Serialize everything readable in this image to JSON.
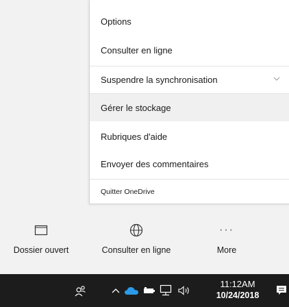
{
  "menu": {
    "items": [
      {
        "label": "Options"
      },
      {
        "label": "Consulter en ligne"
      },
      {
        "label": "Suspendre la synchronisation"
      },
      {
        "label": "Gérer le stockage"
      },
      {
        "label": "Rubriques d'aide"
      },
      {
        "label": "Envoyer des commentaires"
      },
      {
        "label": "Quitter OneDrive"
      }
    ]
  },
  "bottom_bar": {
    "open_folder": "Dossier ouvert",
    "view_online": "Consulter en ligne",
    "more": "More",
    "more_glyph": "···"
  },
  "taskbar": {
    "time": "11:12AM",
    "date": "10/24/2018"
  },
  "colors": {
    "panel_bg": "#f2f2f2",
    "menu_bg": "#ffffff",
    "hover_bg": "#f0f0f0",
    "taskbar_bg": "#1c1c1c",
    "onedrive_blue": "#2b9ae8"
  },
  "icons": {
    "people": "people-icon",
    "chevron_up": "chevron-up-icon",
    "onedrive": "onedrive-cloud-icon",
    "battery": "battery-icon",
    "network": "network-icon",
    "volume": "volume-icon",
    "notifications": "action-center-icon",
    "folder": "folder-icon",
    "globe": "globe-icon",
    "chevron_down": "chevron-down-icon"
  }
}
